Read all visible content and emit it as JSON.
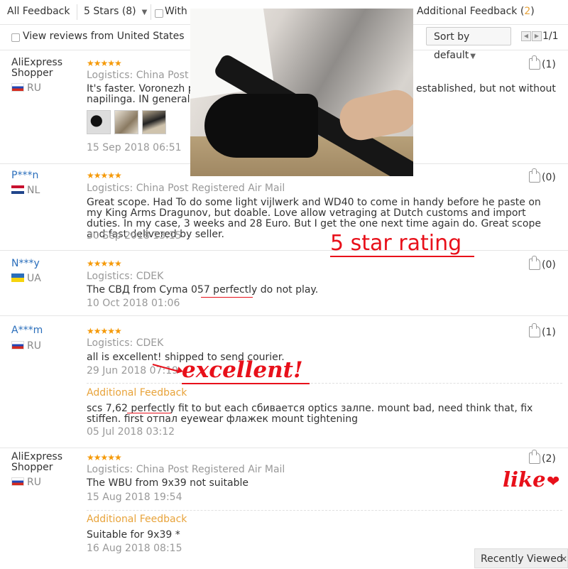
{
  "filters": {
    "all_feedback": "All Feedback",
    "stars_select": "5 Stars (8)",
    "with_label": "With",
    "additional_feedback_label": "Additional Feedback (",
    "additional_feedback_count": "2",
    "additional_feedback_close": ")",
    "view_us": "View reviews from United States",
    "sort": "Sort by default",
    "page": "1/1"
  },
  "annotations": {
    "rating": "5 star rating",
    "excellent": "excellent!",
    "like": "like",
    "heart": "❤"
  },
  "reviews": [
    {
      "user": "AliExpress Shopper",
      "country": "RU",
      "stars": "★★★★★",
      "logistics": "Logistics: China Post R",
      "text1": "It's faster. Voronezh p",
      "text1b": "established, but not without",
      "text2": "napilinga. IN general, i",
      "date": "15 Sep 2018 06:51",
      "likes": "(1)"
    },
    {
      "user": "P***n",
      "country": "NL",
      "stars": "★★★★★",
      "logistics": "Logistics: China Post Registered Air Mail",
      "text": "Great scope. Had To do some light vijlwerk and WD40 to come in handy before he paste on my King Arms Dragunov, but doable. Love allow vetraging at Dutch customs and import duties. In my case, 3 weeks and 28 Euro. But I get the one next time again do. Great scope and fast delivered by seller.",
      "date": "30 Sep 2018 13:15",
      "likes": "(0)"
    },
    {
      "user": "N***y",
      "country": "UA",
      "stars": "★★★★★",
      "logistics": "Logistics: CDEK",
      "text": "The СВД from Cyma 057 perfectly do not play.",
      "date": "10 Oct 2018 01:06",
      "likes": "(0)"
    },
    {
      "user": "A***m",
      "country": "RU",
      "stars": "★★★★★",
      "logistics": "Logistics: CDEK",
      "text": "all is excellent! shipped to send courier.",
      "date": "29 Jun 2018 07:19",
      "likes": "(1)",
      "additional_label": "Additional Feedback",
      "additional_text": "scs 7,62 perfectly fit to but each сбивается optics залпе. mount bad, need think that, fix stiffen. first отпал eyewear флажек mount tightening",
      "additional_date": "05 Jul 2018 03:12"
    },
    {
      "user": "AliExpress Shopper",
      "country": "RU",
      "stars": "★★★★★",
      "logistics": "Logistics: China Post Registered Air Mail",
      "text": "The WBU from 9x39 not suitable",
      "date": "15 Aug 2018 19:54",
      "likes": "(2)",
      "additional_label": "Additional Feedback",
      "additional_text": "Suitable for 9x39 *",
      "additional_date": "16 Aug 2018 08:15"
    }
  ],
  "recently_viewed": "Recently Viewed",
  "recently_viewed_close": "✕"
}
